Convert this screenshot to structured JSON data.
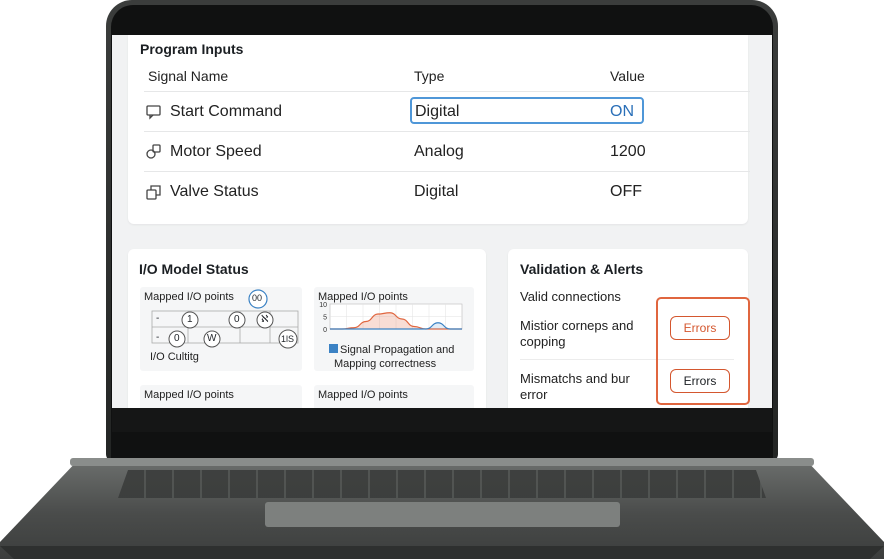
{
  "program_inputs": {
    "title": "Program Inputs",
    "headers": {
      "signal_name": "Signal Name",
      "type": "Type",
      "value": "Value"
    },
    "rows": [
      {
        "name": "Start Command",
        "type": "Digital",
        "value": "ON",
        "icon": "chat-screen-icon",
        "selected": true
      },
      {
        "name": "Motor Speed",
        "type": "Analog",
        "value": "1200",
        "icon": "shapes-icon"
      },
      {
        "name": "Valve Status",
        "type": "Digital",
        "value": "OFF",
        "icon": "copy-stack-icon"
      }
    ]
  },
  "io_model": {
    "title": "I/O Model Status",
    "panels": [
      {
        "label": "Mapped I/O points",
        "nodes_row1": [
          "-",
          "1",
          "0",
          "ℵ"
        ],
        "nodes_row2": [
          "-",
          "0",
          "W",
          "1lS"
        ],
        "badge": "00",
        "caption": "I/O Cultitg"
      },
      {
        "label": "Mapped I/O points",
        "legend": "Signal Propagation and Mapping correctness",
        "chart_data": {
          "type": "area",
          "ylim": [
            0,
            10
          ],
          "yticks": [
            "10",
            "5",
            "0"
          ],
          "series": [
            {
              "color": "#e0663f",
              "values": [
                0,
                0,
                0.5,
                3,
                6,
                6.5,
                4,
                1,
                0,
                0,
                0,
                0
              ]
            },
            {
              "color": "#3b82c4",
              "values": [
                0,
                0,
                0,
                0,
                0,
                0,
                0,
                0,
                0,
                2.5,
                0,
                0
              ]
            }
          ]
        }
      },
      {
        "label": "Mapped I/O points"
      },
      {
        "label": "Mapped I/O points"
      }
    ]
  },
  "validation": {
    "title": "Validation & Alerts",
    "items": [
      {
        "text": "Valid connections"
      },
      {
        "text": "Mistior corneps and copping",
        "button": "Errors"
      },
      {
        "text": "Mismatchs and bur error",
        "button": "Errors"
      }
    ],
    "colors": {
      "alert": "#e0663f"
    }
  }
}
